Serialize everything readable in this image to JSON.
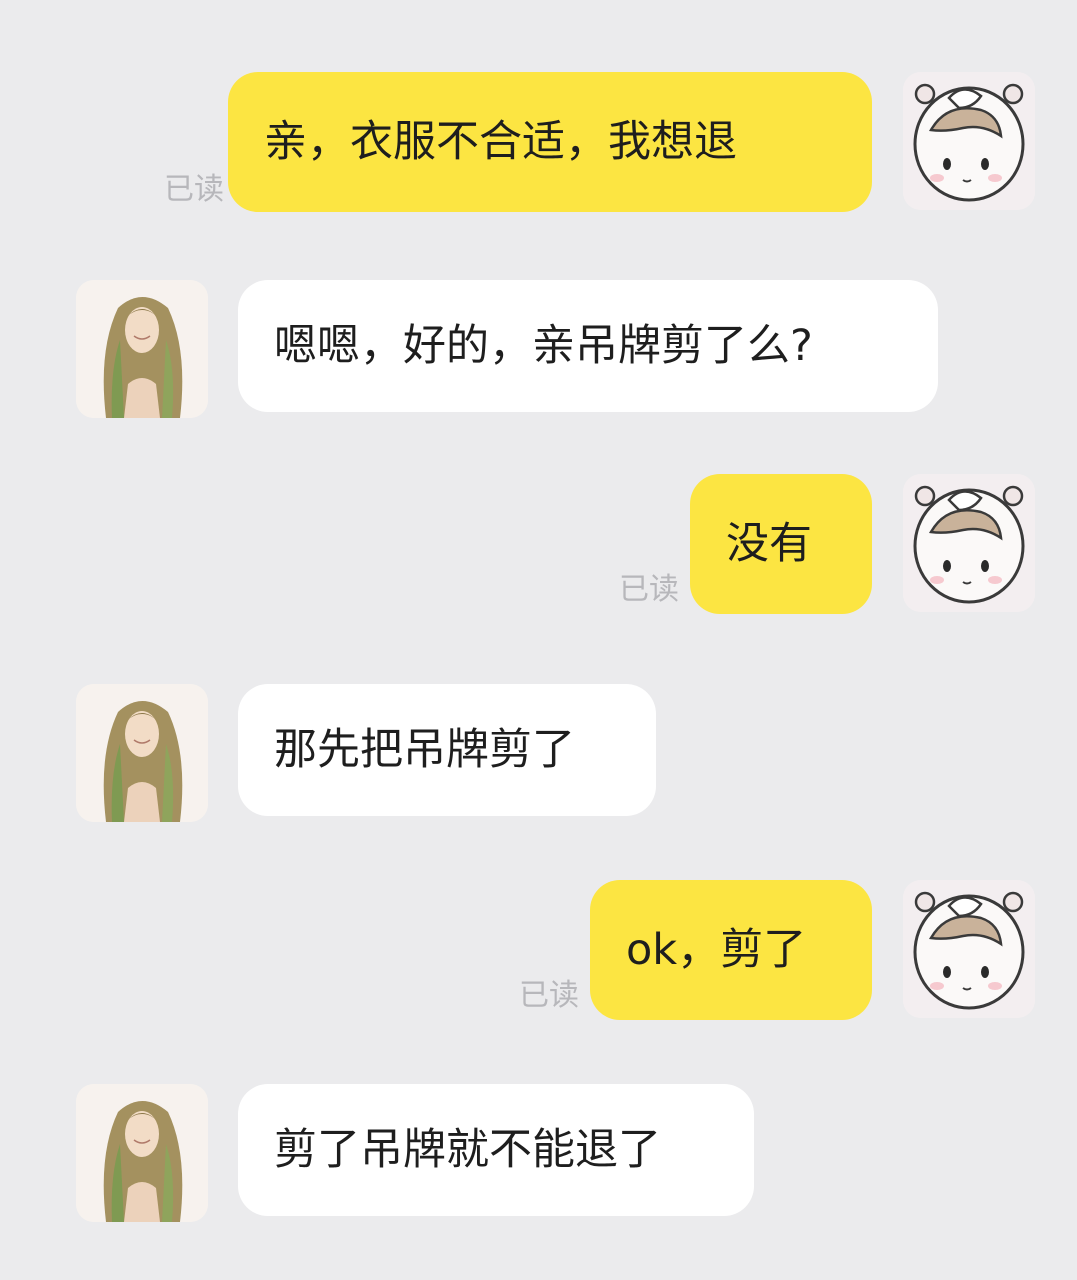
{
  "messages": [
    {
      "side": "self",
      "text": "亲，衣服不合适，我想退",
      "status": "已读"
    },
    {
      "side": "other",
      "text": "嗯嗯，好的，亲吊牌剪了么?"
    },
    {
      "side": "self",
      "text": "没有",
      "status": "已读"
    },
    {
      "side": "other",
      "text": "那先把吊牌剪了"
    },
    {
      "side": "self",
      "text": "ok，剪了",
      "status": "已读"
    },
    {
      "side": "other",
      "text": "剪了吊牌就不能退了"
    }
  ],
  "avatars": {
    "self": "cartoon-girl-avatar-icon",
    "other": "long-hair-woman-avatar-icon"
  },
  "colors": {
    "background": "#ebebed",
    "self_bubble": "#fce542",
    "other_bubble": "#ffffff",
    "read_status": "#b7b7bb"
  }
}
